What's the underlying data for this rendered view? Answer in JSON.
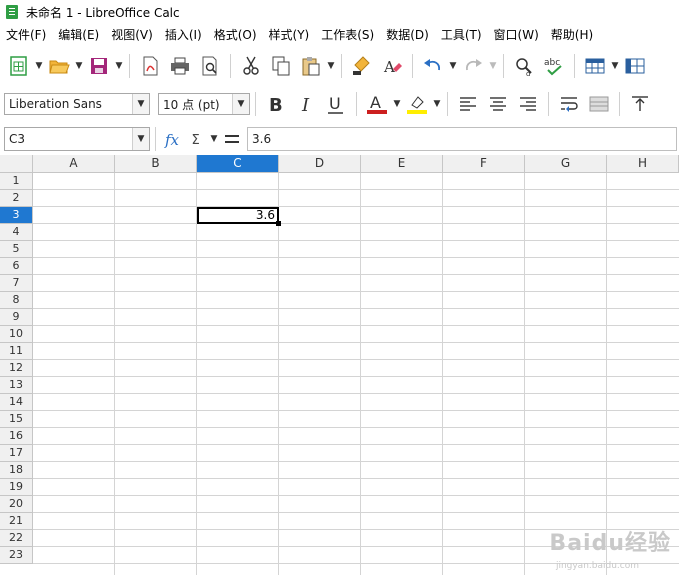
{
  "window": {
    "title": "未命名 1 - LibreOffice Calc"
  },
  "menu": [
    "文件(F)",
    "编辑(E)",
    "视图(V)",
    "插入(I)",
    "格式(O)",
    "样式(Y)",
    "工作表(S)",
    "数据(D)",
    "工具(T)",
    "窗口(W)",
    "帮助(H)"
  ],
  "toolbar2": {
    "font_name": "Liberation Sans",
    "font_size": "10 点 (pt)",
    "font_color_accent": "#cc1f1f",
    "highlight_color_accent": "#ffee00"
  },
  "formula_bar": {
    "name_box": "C3",
    "formula": "3.6"
  },
  "sheet": {
    "columns": [
      "A",
      "B",
      "C",
      "D",
      "E",
      "F",
      "G",
      "H"
    ],
    "selected_column": "C",
    "rows": [
      "1",
      "2",
      "3",
      "4",
      "5",
      "6",
      "7",
      "8",
      "9",
      "10",
      "11",
      "12",
      "13",
      "14",
      "15",
      "16",
      "17",
      "18",
      "19",
      "20",
      "21",
      "22",
      "23"
    ],
    "selected_row": "3",
    "active_cell": {
      "ref": "C3",
      "value": "3.6"
    }
  },
  "colors": {
    "selection": "#1f78d1",
    "header_bg": "#f0f0f0",
    "gridline": "#d4d4d4"
  },
  "watermark": {
    "text": "Baidu经验",
    "sub": "jingyan.baidu.com"
  }
}
